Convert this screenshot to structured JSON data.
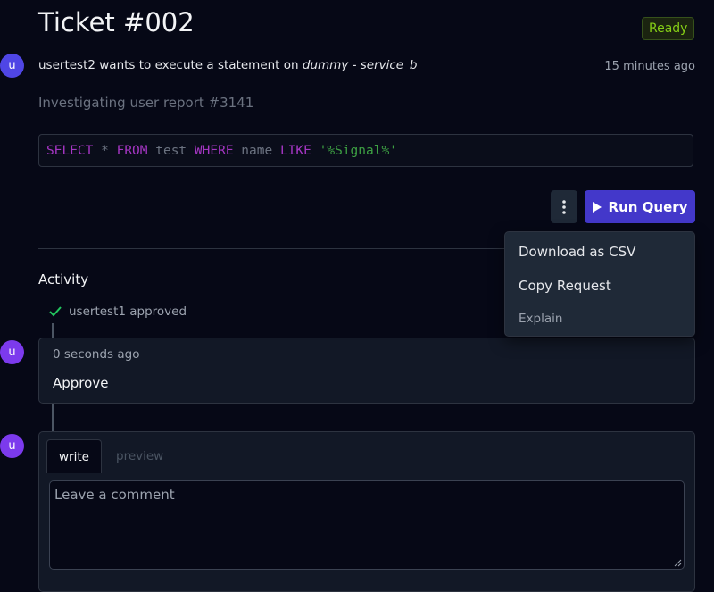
{
  "ticket": {
    "title": "Ticket #002",
    "status": "Ready",
    "requester_avatar": "u",
    "requester": "usertest2",
    "action_text": " wants to execute a statement on ",
    "target": "dummy - service_b",
    "timestamp": "15 minutes ago",
    "description": "Investigating user report #3141"
  },
  "query": {
    "tokens": [
      {
        "text": "SELECT",
        "kind": "kw"
      },
      {
        "text": " * ",
        "kind": "plain"
      },
      {
        "text": "FROM",
        "kind": "kw"
      },
      {
        "text": " test ",
        "kind": "plain"
      },
      {
        "text": "WHERE",
        "kind": "kw"
      },
      {
        "text": " name ",
        "kind": "plain"
      },
      {
        "text": "LIKE",
        "kind": "kw"
      },
      {
        "text": " ",
        "kind": "plain"
      },
      {
        "text": "'%Signal%'",
        "kind": "str"
      }
    ]
  },
  "actions": {
    "more_icon": "vertical-ellipsis-icon",
    "run_icon": "play-icon",
    "run_label": "Run Query"
  },
  "menu": {
    "download": "Download as CSV",
    "copy": "Copy Request",
    "explain": "Explain"
  },
  "activity": {
    "title": "Activity",
    "approval_text": "usertest1 approved",
    "comment": {
      "avatar": "u",
      "time": "0 seconds ago",
      "body": "Approve"
    }
  },
  "composer": {
    "avatar": "u",
    "tab_write": "write",
    "tab_preview": "preview",
    "placeholder": "Leave a comment"
  },
  "colors": {
    "background": "#060816",
    "accent": "#4338ca",
    "ready": "#84cc16",
    "sql_keyword": "#a636c4",
    "sql_string": "#3da043"
  }
}
